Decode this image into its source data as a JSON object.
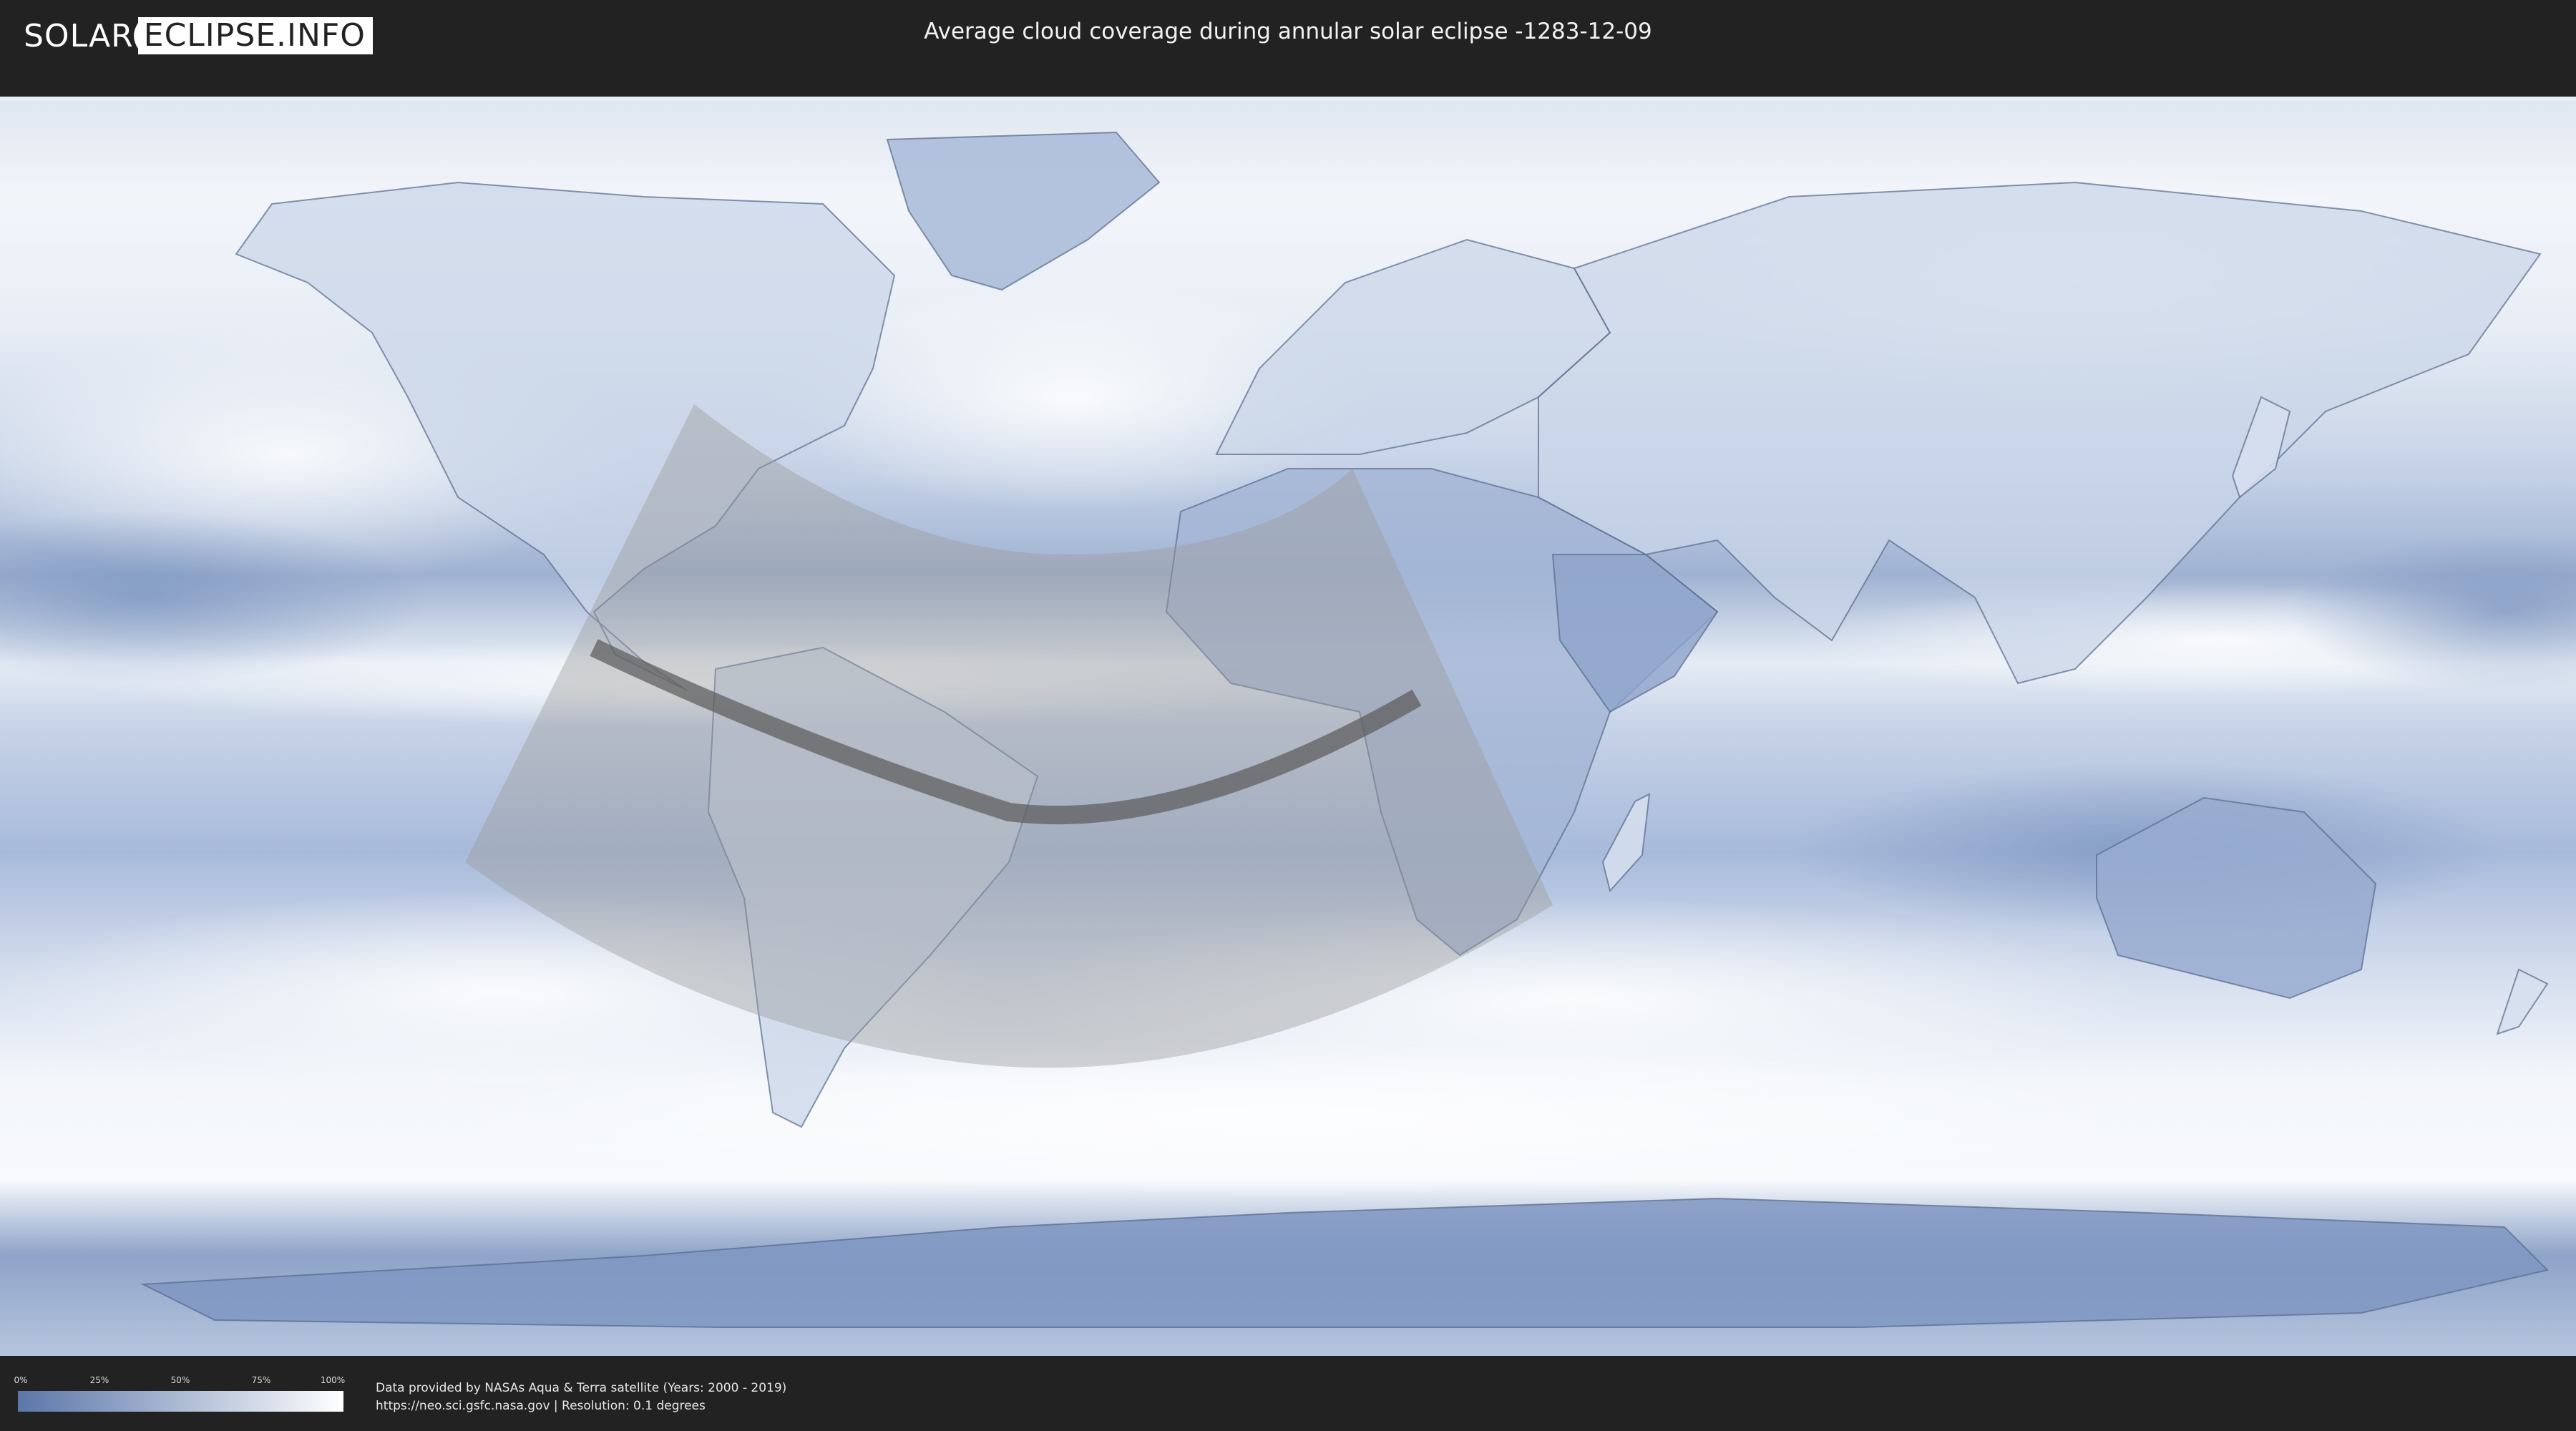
{
  "header": {
    "logo_part1": "SOLAR",
    "logo_part2": "ECLIPSE.INFO",
    "title": "Average cloud coverage during annular solar eclipse -1283-12-09"
  },
  "map": {
    "colors": {
      "ocean_clear": "#6e8ab8",
      "cloud": "#f4f7fb",
      "eclipse_zone": "#9a9a9a",
      "central_path": "#5c5c5c",
      "coastline": "#4a5b78"
    }
  },
  "legend": {
    "ticks": [
      "0%",
      "25%",
      "50%",
      "75%",
      "100%"
    ],
    "color_low": "#5b76a8",
    "color_high": "#ffffff"
  },
  "credits": {
    "line1": "Data provided by NASAs Aqua & Terra satellite (Years: 2000 - 2019)",
    "line2": "https://neo.sci.gsfc.nasa.gov | Resolution: 0.1 degrees"
  }
}
